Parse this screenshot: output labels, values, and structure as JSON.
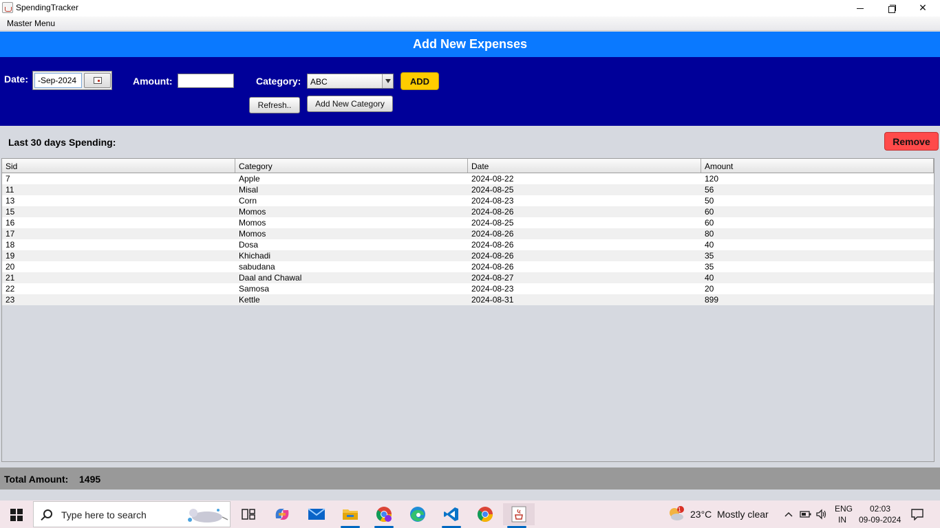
{
  "window": {
    "title": "SpendingTracker",
    "minimize": "—",
    "close": "✕"
  },
  "menu": {
    "master": "Master Menu"
  },
  "header": {
    "title": "Add New Expenses"
  },
  "form": {
    "date_label": "Date:",
    "date_value": "-Sep-2024",
    "amount_label": "Amount:",
    "amount_value": "",
    "category_label": "Category:",
    "category_value": "ABC",
    "add_label": "ADD",
    "refresh_label": "Refresh..",
    "new_category_label": "Add New Category"
  },
  "spending": {
    "label": "Last 30 days  Spending:",
    "remove_label": "Remove"
  },
  "table": {
    "columns": [
      "Sid",
      "Category",
      "Date",
      "Amount"
    ],
    "rows": [
      [
        "7",
        "Apple",
        "2024-08-22",
        "120"
      ],
      [
        "11",
        "Misal",
        "2024-08-25",
        "56"
      ],
      [
        "13",
        "Corn",
        "2024-08-23",
        "50"
      ],
      [
        "15",
        "Momos",
        "2024-08-26",
        "60"
      ],
      [
        "16",
        "Momos",
        "2024-08-25",
        "60"
      ],
      [
        "17",
        "Momos",
        "2024-08-26",
        "80"
      ],
      [
        "18",
        "Dosa",
        "2024-08-26",
        "40"
      ],
      [
        "19",
        "Khichadi",
        "2024-08-26",
        "35"
      ],
      [
        "20",
        "sabudana",
        "2024-08-26",
        "35"
      ],
      [
        "21",
        "Daal and Chawal",
        "2024-08-27",
        "40"
      ],
      [
        "22",
        "Samosa",
        "2024-08-23",
        "20"
      ],
      [
        "23",
        "Kettle",
        "2024-08-31",
        "899"
      ]
    ]
  },
  "total": {
    "label": "Total Amount:",
    "value": "1495"
  },
  "taskbar": {
    "search_placeholder": "Type here to search",
    "weather_temp": "23°C",
    "weather_text": "Mostly clear",
    "weather_badge": "1",
    "lang_top": "ENG",
    "lang_bottom": "IN",
    "time": "02:03",
    "date": "09-09-2024"
  },
  "colors": {
    "header_bg": "#0a79ff",
    "form_bg": "#000099",
    "add_button": "#ffcc00",
    "remove_button": "#ff4a4a",
    "total_bar": "#999999"
  },
  "icons": [
    "app-icon",
    "calendar-icon",
    "dropdown-arrow-icon",
    "windows-start-icon",
    "search-icon",
    "task-view-icon",
    "copilot-icon",
    "mail-icon",
    "file-explorer-icon",
    "chrome-profile-icon",
    "edge-icon",
    "vscode-icon",
    "chrome-icon",
    "java-icon",
    "weather-icon",
    "chevron-up-icon",
    "battery-icon",
    "speaker-icon",
    "notification-icon"
  ]
}
